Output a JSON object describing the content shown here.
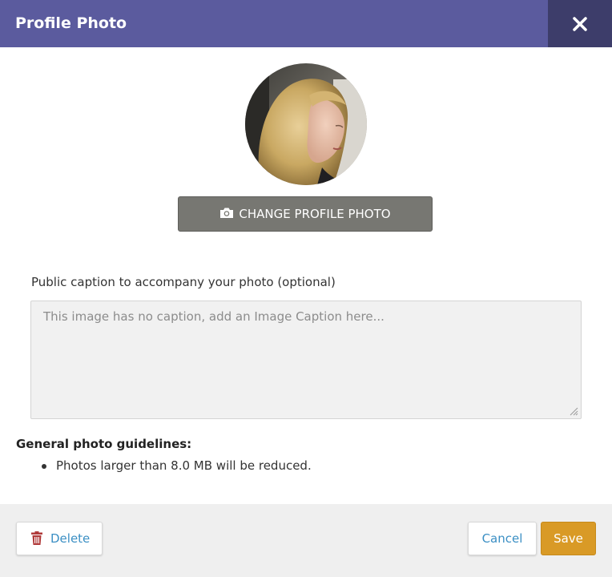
{
  "dialog": {
    "title": "Profile Photo",
    "close_icon": "close-icon"
  },
  "avatar": {
    "icon": "profile-photo"
  },
  "change_photo": {
    "label": "CHANGE PROFILE PHOTO",
    "icon": "camera-icon"
  },
  "caption": {
    "label": "Public caption to accompany your photo (optional)",
    "placeholder": "This image has no caption, add an Image Caption here...",
    "value": ""
  },
  "guidelines": {
    "heading": "General photo guidelines:",
    "items": [
      "Photos larger than 8.0 MB will be reduced."
    ]
  },
  "footer": {
    "delete_label": "Delete",
    "delete_icon": "trash-icon",
    "cancel_label": "Cancel",
    "save_label": "Save"
  },
  "colors": {
    "header": "#5b5b9e",
    "close_bg": "#3d3d6a",
    "change_photo_bg": "#777772",
    "save_bg": "#d99a26",
    "link_blue": "#3b8fc4",
    "delete_icon": "#b03a3a"
  }
}
